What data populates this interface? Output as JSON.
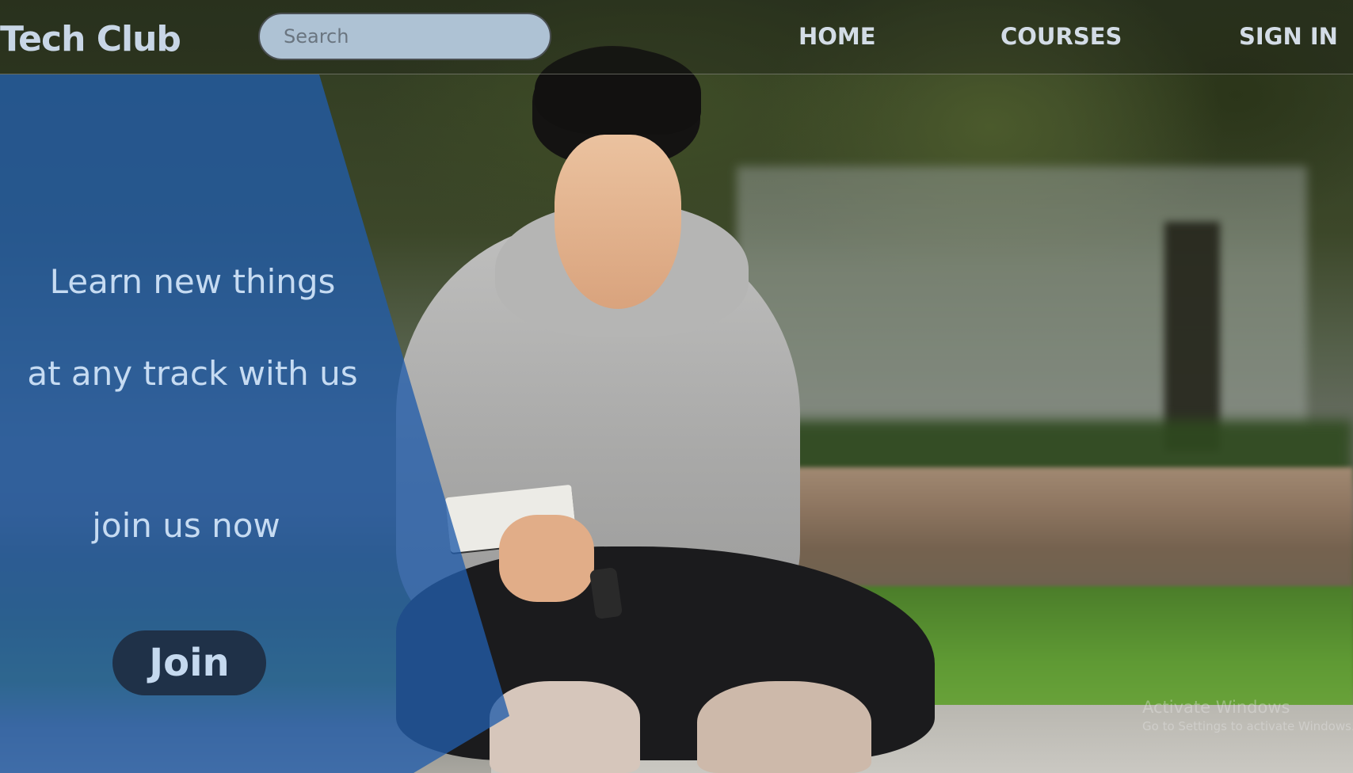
{
  "navbar": {
    "brand": "Tech Club",
    "search_placeholder": "Search",
    "links": [
      {
        "label": "HOME"
      },
      {
        "label": "COURSES"
      },
      {
        "label": "SIGN IN"
      }
    ]
  },
  "hero": {
    "line_1": "Learn new things",
    "line_2": "at any track with us",
    "line_3": "join us now",
    "button_label": "Join",
    "panel_color": "#215caa"
  },
  "background": {
    "description_icon": "student-photo"
  },
  "watermark": {
    "title": "Activate Windows",
    "subtitle": "Go to Settings to activate Windows."
  }
}
